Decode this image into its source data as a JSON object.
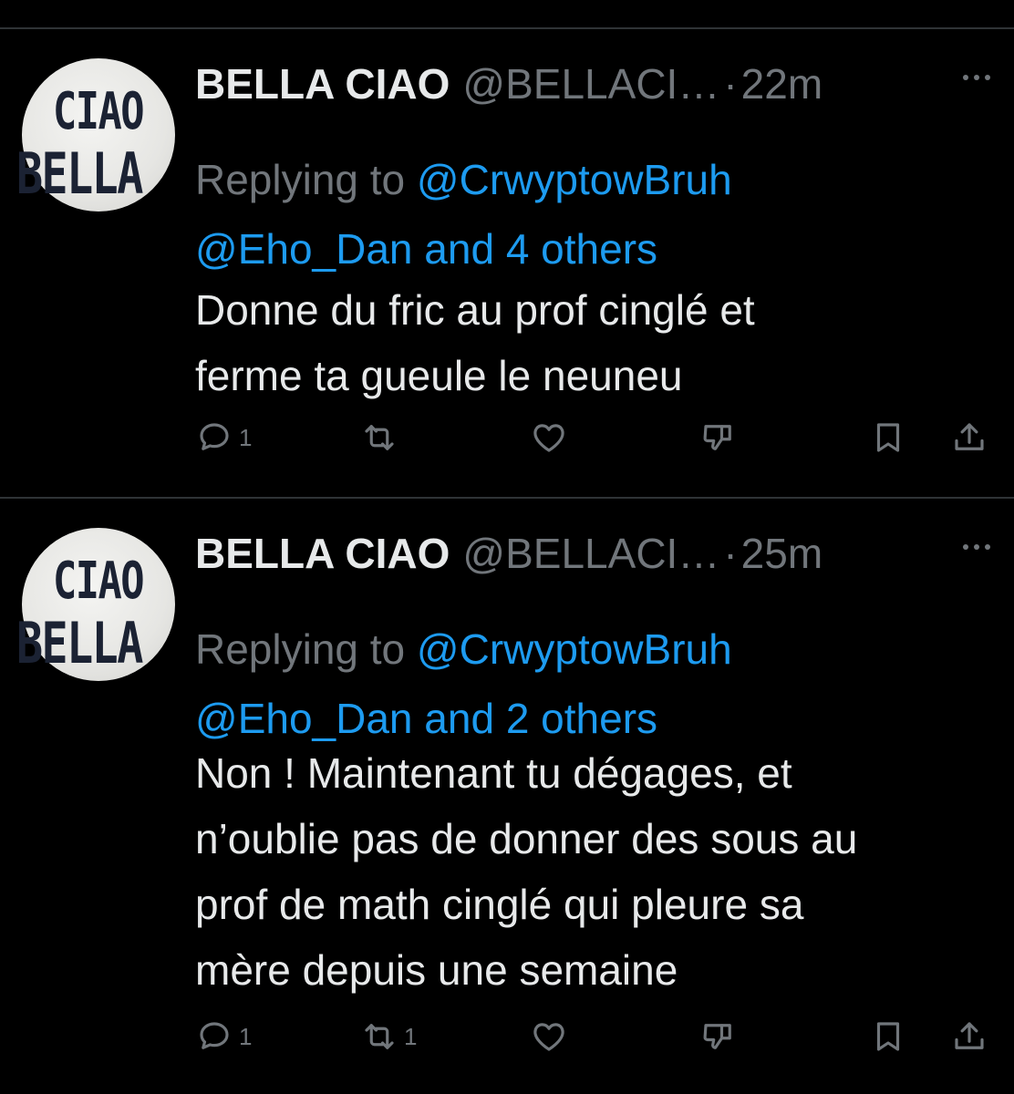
{
  "tweets": [
    {
      "avatar": {
        "line1": "CIAO",
        "line2": "BELLA"
      },
      "display_name": "BELLA CIAO",
      "handle": "@BELLACI…",
      "separator": "·",
      "time": "22m",
      "replying_prefix": "Replying to",
      "reply_to_primary": "@CrwyptowBruh",
      "reply_to_secondary": "@Eho_Dan and 4 others",
      "text_lines": [
        "Donne du fric au prof cinglé et",
        "ferme ta gueule le neuneu"
      ],
      "actions": {
        "reply_count": "1",
        "retweet_count": "",
        "like_count": "",
        "dislike_count": ""
      }
    },
    {
      "avatar": {
        "line1": "CIAO",
        "line2": "BELLA"
      },
      "display_name": "BELLA CIAO",
      "handle": "@BELLACI…",
      "separator": "·",
      "time": "25m",
      "replying_prefix": "Replying to",
      "reply_to_primary": "@CrwyptowBruh",
      "reply_to_secondary": "@Eho_Dan and 2 others",
      "text_lines": [
        "Non ! Maintenant tu dégages, et",
        "n’oublie pas de donner des sous au",
        "prof de math cinglé qui pleure sa",
        "mère depuis une semaine"
      ],
      "actions": {
        "reply_count": "1",
        "retweet_count": "1",
        "like_count": "",
        "dislike_count": ""
      }
    }
  ],
  "colors": {
    "background": "#000000",
    "text": "#e7e9ea",
    "muted": "#71767b",
    "link": "#1d9bf0",
    "divider": "#2f3336"
  },
  "icons": [
    "reply-icon",
    "retweet-icon",
    "like-icon",
    "dislike-icon",
    "bookmark-icon",
    "share-icon",
    "more-icon"
  ]
}
